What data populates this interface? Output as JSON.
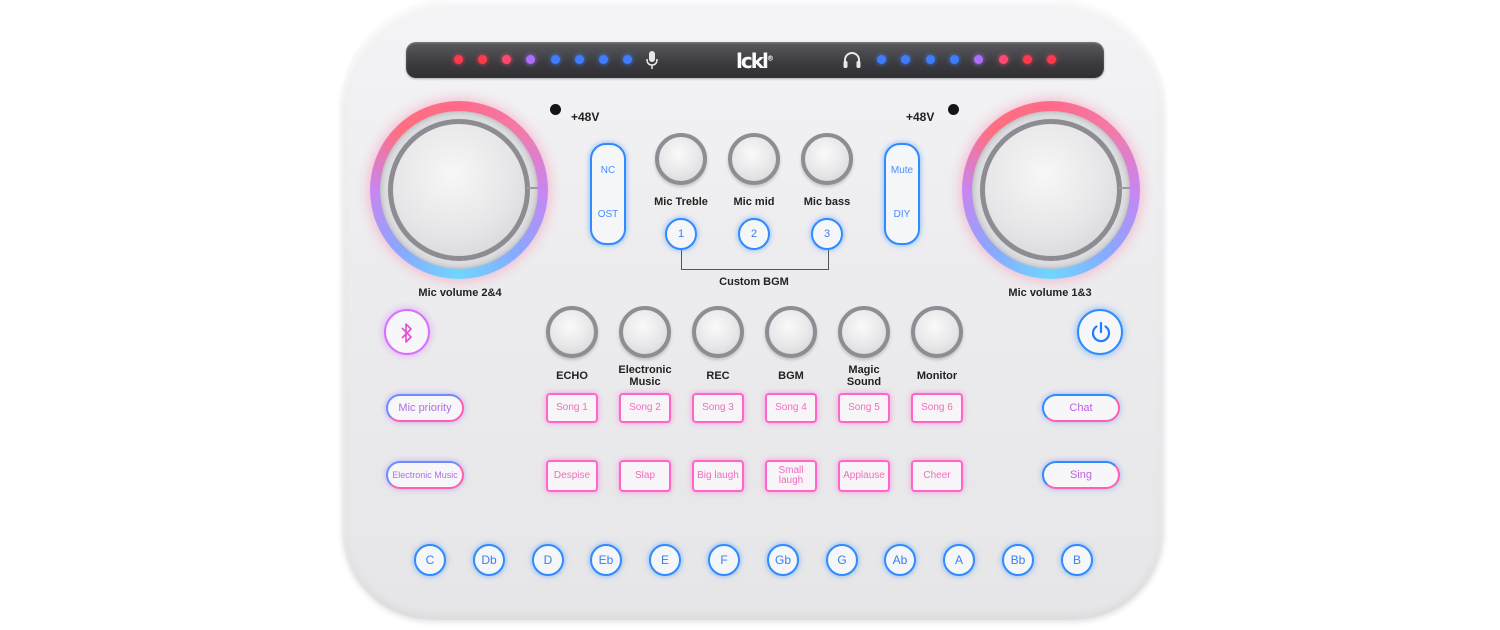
{
  "brand": {
    "logo": "lckl",
    "registered": "®"
  },
  "leds_left": [
    "#ff3a4a",
    "#ff3a4a",
    "#ff4a70",
    "#b06cff",
    "#3f7dff",
    "#3f7dff",
    "#3f7dff",
    "#3f7dff"
  ],
  "leds_right": [
    "#3f7dff",
    "#3f7dff",
    "#3f7dff",
    "#3f7dff",
    "#b06cff",
    "#ff4a70",
    "#ff3a4a",
    "#ff3a4a"
  ],
  "phantom_power": {
    "left": "+48V",
    "right": "+48V"
  },
  "mic_volume": {
    "left": "Mic volume 2&4",
    "right": "Mic volume 1&3"
  },
  "mode_left": {
    "top": "NC",
    "bottom": "OST"
  },
  "mode_right": {
    "top": "Mute",
    "bottom": "DIY"
  },
  "eq_knobs": {
    "treble": "Mic Treble",
    "mid": "Mic mid",
    "bass": "Mic bass"
  },
  "bgm_buttons": [
    "1",
    "2",
    "3"
  ],
  "custom_bgm_label": "Custom BGM",
  "effect_knobs": [
    "ECHO",
    "Electronic\nMusic",
    "REC",
    "BGM",
    "Magic\nSound",
    "Monitor"
  ],
  "songs": [
    "Song 1",
    "Song 2",
    "Song 3",
    "Song 4",
    "Song 5",
    "Song 6"
  ],
  "sound_effects": [
    "Despise",
    "Slap",
    "Big laugh",
    "Small\nlaugh",
    "Applause",
    "Cheer"
  ],
  "left_pills": {
    "top": "Mic priority",
    "bottom": "Electronic Music"
  },
  "right_pills": {
    "top": "Chat",
    "bottom": "Sing"
  },
  "icons": {
    "bluetooth": "bluetooth-icon",
    "power": "power-icon",
    "mic": "mic-icon",
    "headphones": "headphones-icon"
  },
  "notes": [
    "C",
    "Db",
    "D",
    "Eb",
    "E",
    "F",
    "Gb",
    "G",
    "Ab",
    "A",
    "Bb",
    "B"
  ]
}
